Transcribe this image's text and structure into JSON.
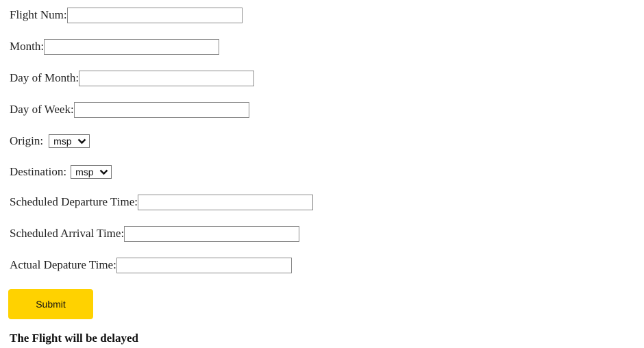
{
  "form": {
    "flight_num": {
      "label": "Flight Num:",
      "value": ""
    },
    "month": {
      "label": "Month:",
      "value": ""
    },
    "day_of_month": {
      "label": "Day of Month:",
      "value": ""
    },
    "day_of_week": {
      "label": "Day of Week:",
      "value": ""
    },
    "origin": {
      "label": "Origin:",
      "selected": "msp"
    },
    "destination": {
      "label": "Destination:",
      "selected": "msp"
    },
    "scheduled_departure": {
      "label": "Scheduled Departure Time:",
      "value": ""
    },
    "scheduled_arrival": {
      "label": "Scheduled Arrival Time:",
      "value": ""
    },
    "actual_departure": {
      "label": "Actual Depature Time:",
      "value": ""
    },
    "submit_label": "Submit"
  },
  "result": {
    "text": "The Flight will be delayed"
  },
  "colors": {
    "submit_bg": "#ffd200",
    "field_border": "#8a8a8a"
  }
}
